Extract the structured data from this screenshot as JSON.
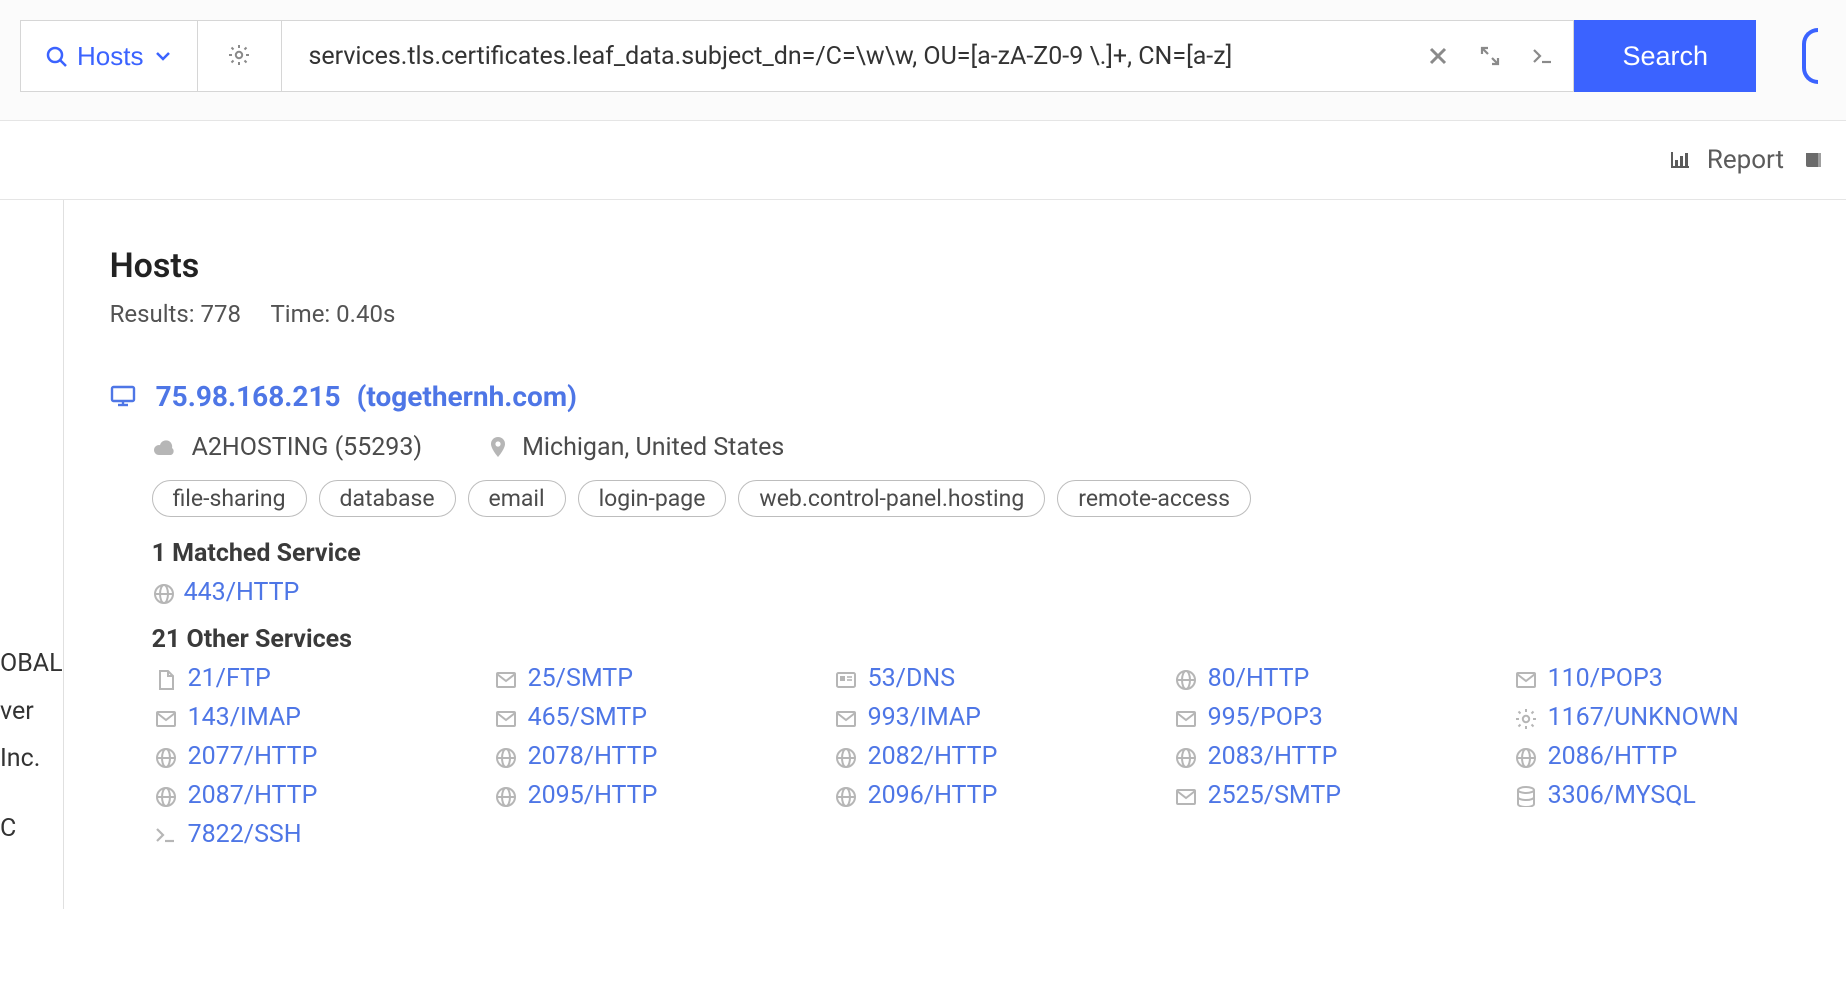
{
  "search": {
    "scope_label": "Hosts",
    "query": "services.tls.certificates.leaf_data.subject_dn=/C=\\w\\w, OU=[a-zA-Z0-9 \\.]+, CN=[a-z]",
    "button_label": "Search"
  },
  "subbar": {
    "report_label": "Report"
  },
  "left_truncated": [
    "OBAL",
    "ver Inc.",
    "C"
  ],
  "page": {
    "title": "Hosts",
    "results_label": "Results: 778",
    "time_label": "Time: 0.40s"
  },
  "host": {
    "ip": "75.98.168.215",
    "domain": "(togethernh.com)",
    "asn": "A2HOSTING (55293)",
    "location": "Michigan, United States",
    "tags": [
      "file-sharing",
      "database",
      "email",
      "login-page",
      "web.control-panel.hosting",
      "remote-access"
    ],
    "matched_label": "1 Matched Service",
    "matched_service": {
      "icon": "globe",
      "text": "443/HTTP"
    },
    "other_label": "21 Other Services",
    "other_services": [
      {
        "icon": "file",
        "text": "21/FTP"
      },
      {
        "icon": "envelope",
        "text": "25/SMTP"
      },
      {
        "icon": "card",
        "text": "53/DNS"
      },
      {
        "icon": "globe",
        "text": "80/HTTP"
      },
      {
        "icon": "envelope",
        "text": "110/POP3"
      },
      {
        "icon": "envelope",
        "text": "143/IMAP"
      },
      {
        "icon": "envelope",
        "text": "465/SMTP"
      },
      {
        "icon": "envelope",
        "text": "993/IMAP"
      },
      {
        "icon": "envelope",
        "text": "995/POP3"
      },
      {
        "icon": "gear",
        "text": "1167/UNKNOWN"
      },
      {
        "icon": "globe",
        "text": "2077/HTTP"
      },
      {
        "icon": "globe",
        "text": "2078/HTTP"
      },
      {
        "icon": "globe",
        "text": "2082/HTTP"
      },
      {
        "icon": "globe",
        "text": "2083/HTTP"
      },
      {
        "icon": "globe",
        "text": "2086/HTTP"
      },
      {
        "icon": "globe",
        "text": "2087/HTTP"
      },
      {
        "icon": "globe",
        "text": "2095/HTTP"
      },
      {
        "icon": "globe",
        "text": "2096/HTTP"
      },
      {
        "icon": "envelope",
        "text": "2525/SMTP"
      },
      {
        "icon": "database",
        "text": "3306/MYSQL"
      },
      {
        "icon": "terminal",
        "text": "7822/SSH"
      }
    ]
  },
  "icons": {
    "file": "file-icon",
    "envelope": "envelope-icon",
    "card": "card-icon",
    "globe": "globe-icon",
    "gear": "gear-icon",
    "database": "database-icon",
    "terminal": "terminal-icon"
  }
}
